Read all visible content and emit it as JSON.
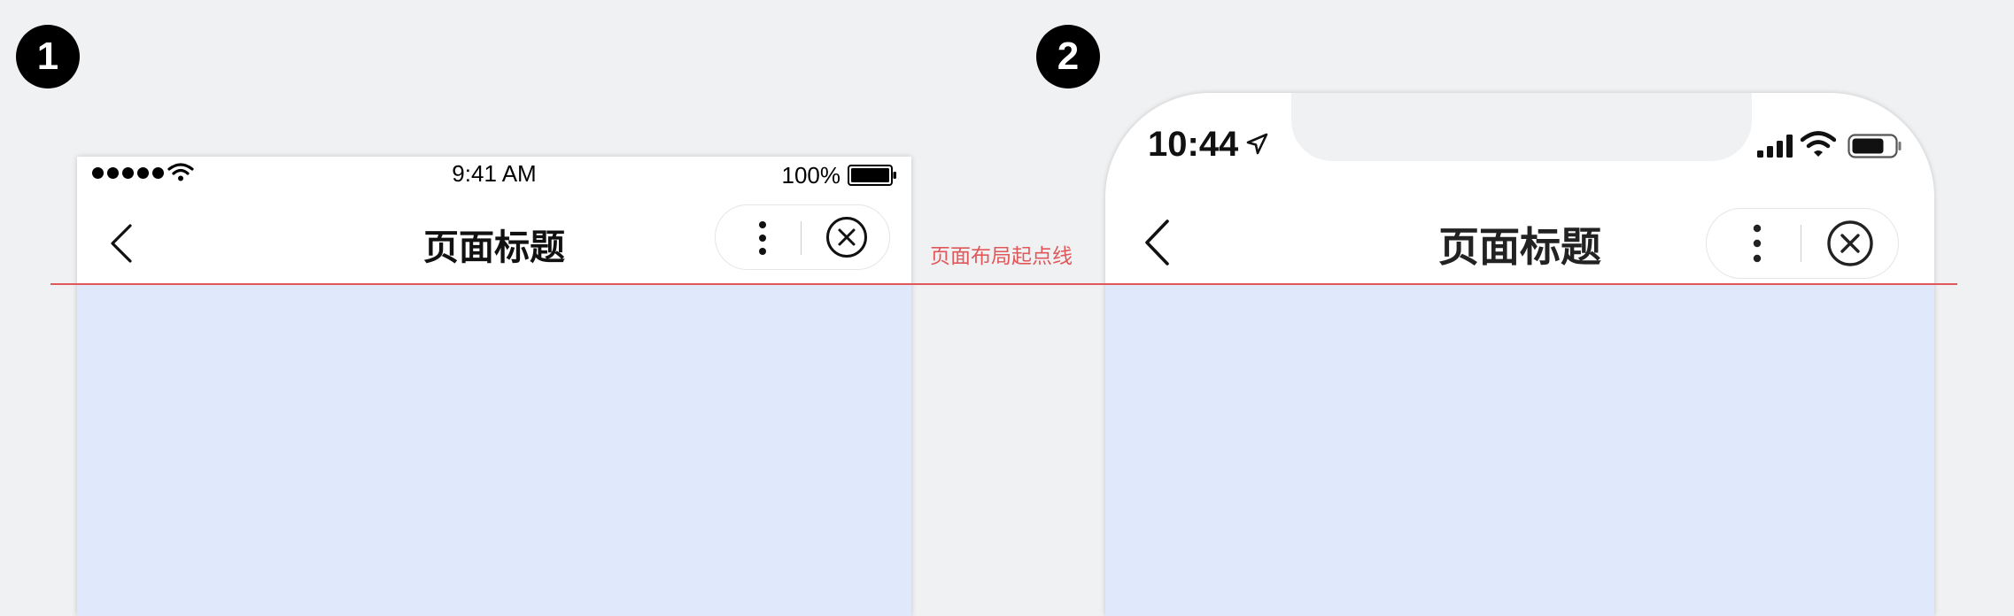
{
  "badges": [
    "1",
    "2"
  ],
  "baseline_label": "页面布局起点线",
  "phone1": {
    "status_bar": {
      "time": "9:41 AM",
      "battery_percent": "100%",
      "signal_dots": 5
    },
    "nav": {
      "title": "页面标题"
    }
  },
  "phone2": {
    "status_bar": {
      "time": "10:44"
    },
    "nav": {
      "title": "页面标题"
    }
  },
  "colors": {
    "background": "#f0f1f3",
    "content": "#e0e9fb",
    "baseline": "#e0585a"
  }
}
